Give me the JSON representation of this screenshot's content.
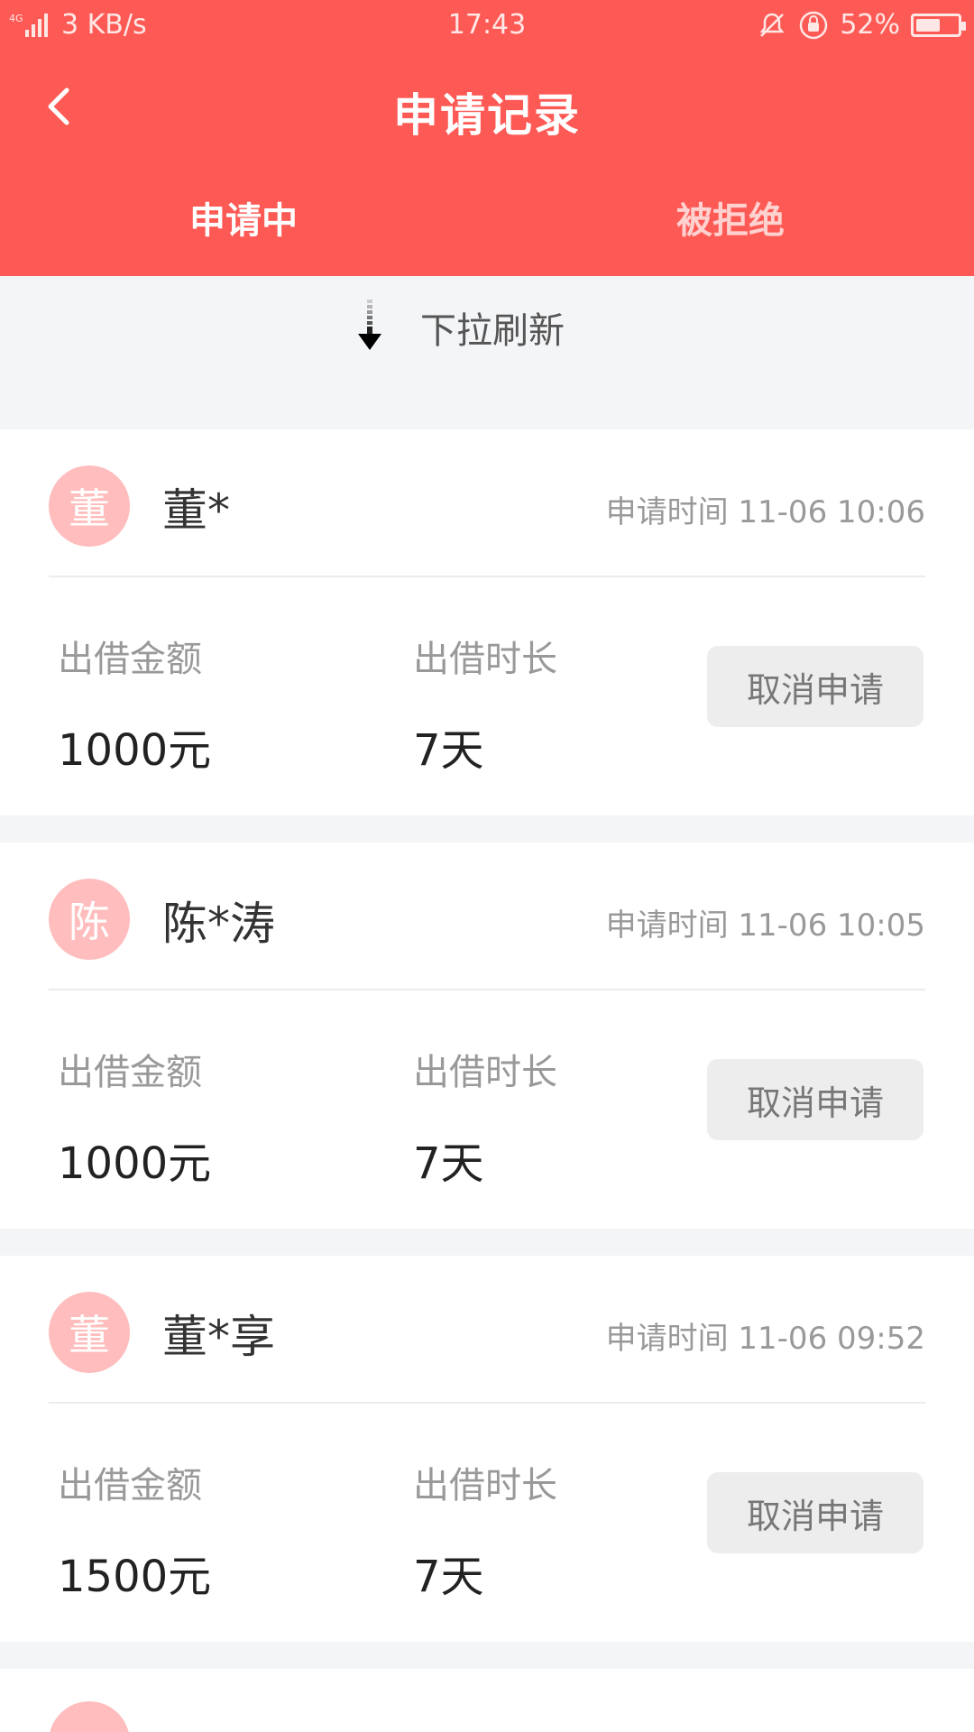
{
  "status_bar": {
    "network": "4G",
    "speed": "3 KB/s",
    "time": "17:43",
    "battery": "52%"
  },
  "header": {
    "title": "申请记录",
    "back_icon": "chevron-left-icon"
  },
  "tabs": [
    {
      "label": "申请中",
      "active": true
    },
    {
      "label": "被拒绝",
      "active": false
    }
  ],
  "refresh": {
    "label": "下拉刷新",
    "icon": "arrow-down-icon"
  },
  "applications": [
    {
      "avatar_char": "董",
      "name": "董*",
      "time": "申请时间 11-06 10:06",
      "amount_label": "出借金额",
      "amount": "1000元",
      "duration_label": "出借时长",
      "duration": "7天",
      "cancel_label": "取消申请"
    },
    {
      "avatar_char": "陈",
      "name": "陈*涛",
      "time": "申请时间 11-06 10:05",
      "amount_label": "出借金额",
      "amount": "1000元",
      "duration_label": "出借时长",
      "duration": "7天",
      "cancel_label": "取消申请"
    },
    {
      "avatar_char": "董",
      "name": "董*享",
      "time": "申请时间 11-06 09:52",
      "amount_label": "出借金额",
      "amount": "1500元",
      "duration_label": "出借时长",
      "duration": "7天",
      "cancel_label": "取消申请"
    }
  ],
  "colors": {
    "header_bg": "#fe5a55",
    "page_bg": "#f4f5f7",
    "avatar_bg": "#ffbdbd"
  }
}
